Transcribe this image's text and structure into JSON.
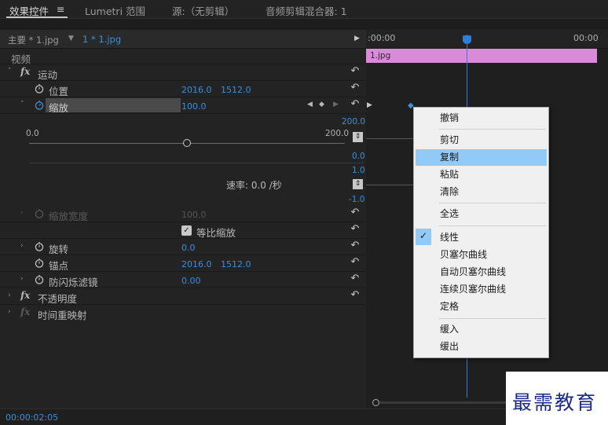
{
  "tabs": [
    {
      "label": "效果控件",
      "active": true
    },
    {
      "label": "≡"
    },
    {
      "label": "Lumetri 范围"
    },
    {
      "label": "源:（无剪辑）"
    },
    {
      "label": "音频剪辑混合器: 1"
    }
  ],
  "header": {
    "master": "主要 * 1.jpg",
    "clip": "1 * 1.jpg",
    "time_start": ":00:00",
    "time_end": "00:00",
    "clip_label": "1.jpg"
  },
  "sections": {
    "video": "视频",
    "motion": "运动",
    "fx": "fx",
    "opacity": "不透明度",
    "time_remap": "时间重映射"
  },
  "params": {
    "position": {
      "label": "位置",
      "x": "2016.0",
      "y": "1512.0"
    },
    "scale": {
      "label": "缩放",
      "value": "100.0"
    },
    "scale_width": {
      "label": "缩放宽度",
      "value": "100.0"
    },
    "uniform_scale": {
      "label": "等比缩放",
      "checked": true
    },
    "rotation": {
      "label": "旋转",
      "value": "0.0"
    },
    "anchor": {
      "label": "锚点",
      "x": "2016.0",
      "y": "1512.0"
    },
    "flicker": {
      "label": "防闪烁滤镜",
      "value": "0.00"
    }
  },
  "graph": {
    "slider_min": "0.0",
    "slider_max": "200.0",
    "value_top": "200.0",
    "value_zero": "0.0",
    "vel_top": "1.0",
    "vel_bottom": "-1.0",
    "rate": "速率: 0.0 /秒"
  },
  "timecode": "00:00:02:05",
  "context_menu": {
    "items": [
      {
        "label": "撤销"
      },
      {
        "label": "剪切"
      },
      {
        "label": "复制",
        "highlighted": true
      },
      {
        "label": "粘贴"
      },
      {
        "label": "清除"
      },
      {
        "label": "全选"
      },
      {
        "label": "线性",
        "checked": true
      },
      {
        "label": "贝塞尔曲线"
      },
      {
        "label": "自动贝塞尔曲线"
      },
      {
        "label": "连续贝塞尔曲线"
      },
      {
        "label": "定格"
      },
      {
        "label": "缓入"
      },
      {
        "label": "缓出"
      }
    ]
  },
  "watermark": "最需教育",
  "colors": {
    "accent": "#3a8fd8",
    "clip": "#d98ad9",
    "playhead": "#2f7fd8",
    "menu_highlight": "#91c9f7"
  }
}
